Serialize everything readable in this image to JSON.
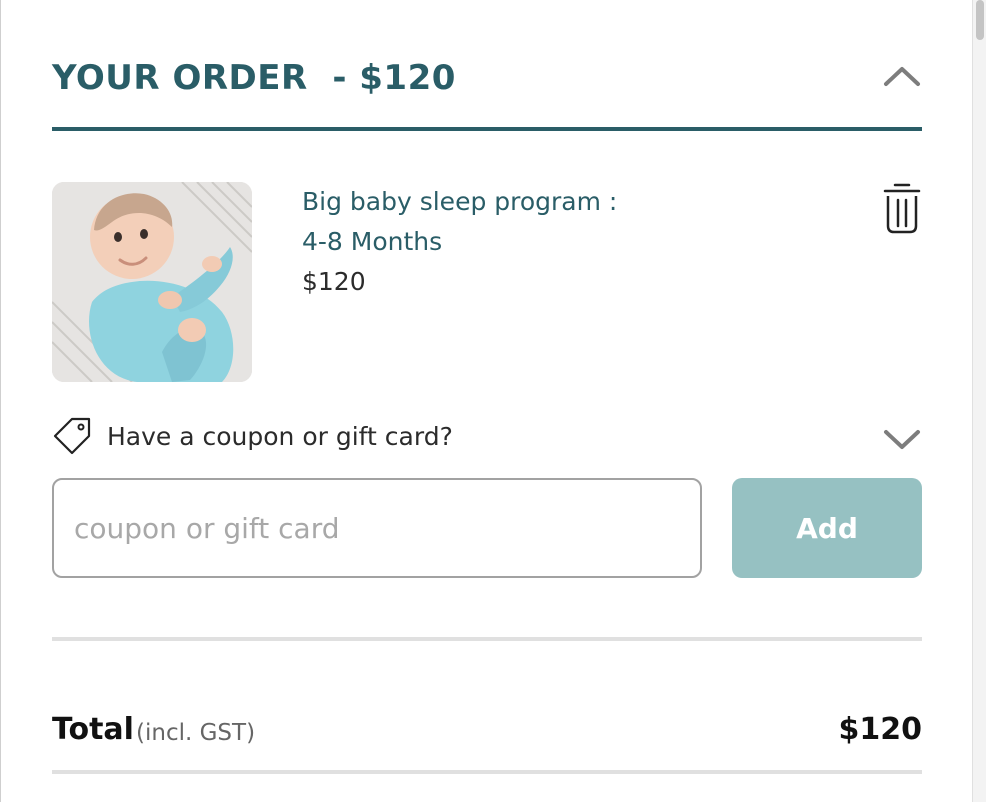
{
  "order": {
    "title": "YOUR ORDER  - $120"
  },
  "item": {
    "name_line1": "Big baby sleep program :",
    "name_line2": "4-8 Months",
    "price": "$120",
    "image_alt": "Baby in light blue pajamas lying on a blanket"
  },
  "coupon": {
    "toggle_label": "Have a coupon or gift card?",
    "input_value": "",
    "input_placeholder": "coupon or gift card",
    "add_label": "Add"
  },
  "total": {
    "label": "Total",
    "note": "(incl. GST)",
    "amount": "$120"
  },
  "icons": {
    "collapse": "chevron-up-icon",
    "remove": "trash-icon",
    "coupon": "tag-icon",
    "expand": "chevron-down-icon"
  },
  "colors": {
    "accent": "#2a5d67",
    "add_button": "#96c1c2",
    "divider": "#e0e0e0",
    "input_border": "#a2a2a2"
  }
}
